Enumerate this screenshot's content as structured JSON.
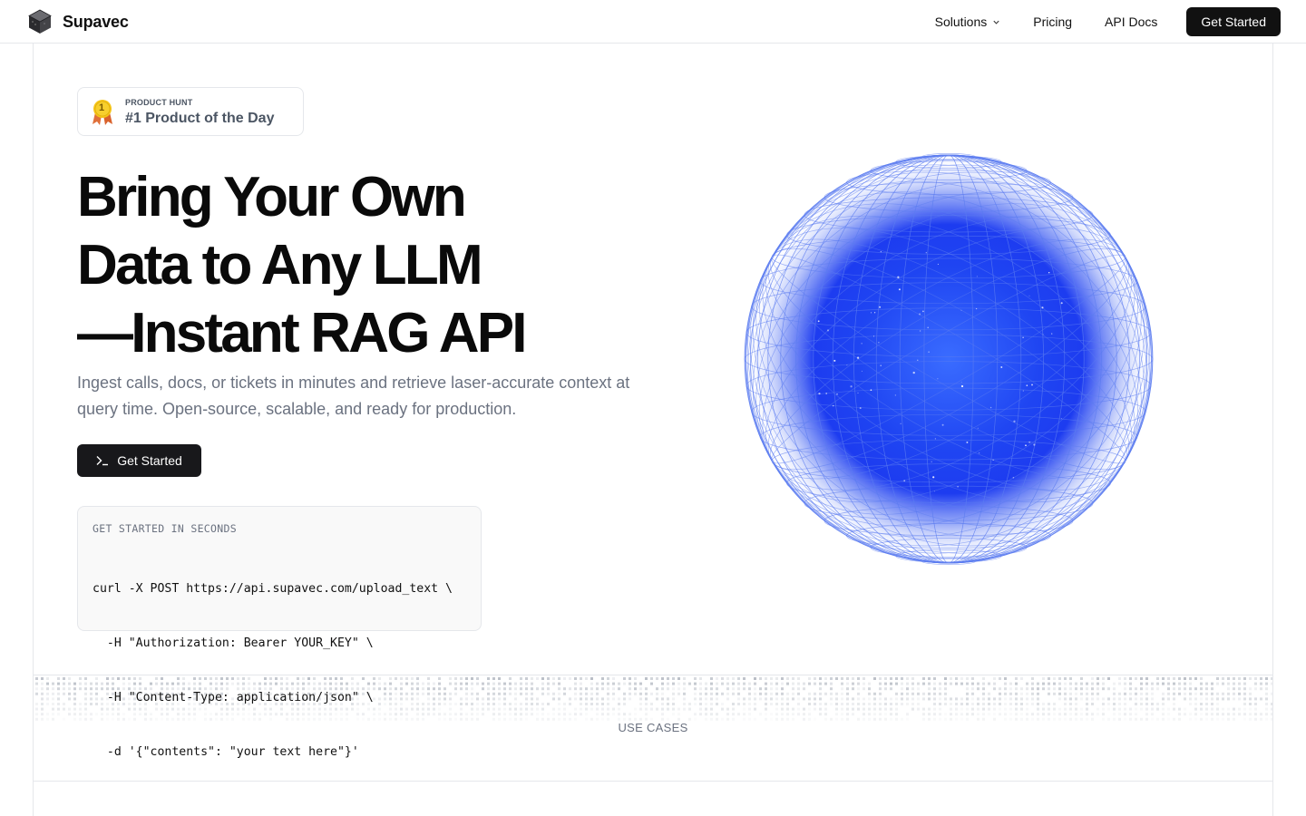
{
  "nav": {
    "brand": "Supavec",
    "links": [
      {
        "label": "Solutions",
        "has_dropdown": true
      },
      {
        "label": "Pricing",
        "has_dropdown": false
      },
      {
        "label": "API Docs",
        "has_dropdown": false
      }
    ],
    "cta_label": "Get Started"
  },
  "badge": {
    "kicker": "PRODUCT HUNT",
    "title": "#1 Product of the Day",
    "medal_number": "1",
    "medal_color": "#f5c518"
  },
  "hero": {
    "headline_lines": [
      "Bring Your Own",
      "Data to Any LLM",
      "—Instant RAG API"
    ],
    "subtext": "Ingest calls, docs, or tickets in minutes and retrieve laser-accurate context at query time. Open-source, scalable, and ready for production.",
    "cta_label": "Get Started",
    "cta_icon": "terminal-prompt-icon"
  },
  "code_card": {
    "label": "GET STARTED IN SECONDS",
    "lines": [
      "curl -X POST https://api.supavec.com/upload_text \\",
      "  -H \"Authorization: Bearer YOUR_KEY\" \\",
      "  -H \"Content-Type: application/json\" \\",
      "  -d '{\"contents\": \"your text here\"}'"
    ]
  },
  "globe": {
    "icon": "wireframe-globe-icon",
    "core_color": "#1d3cf0",
    "wire_color": "#5b7cf0"
  },
  "section": {
    "label": "USE CASES"
  },
  "colors": {
    "accent": "#111111",
    "border": "#e5e7eb",
    "muted_text": "#6b7280"
  }
}
